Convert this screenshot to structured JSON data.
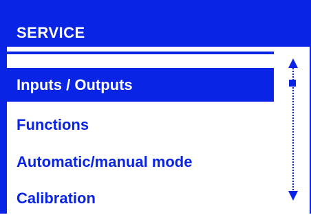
{
  "header": {
    "title": "SERVICE"
  },
  "menu": {
    "items": [
      {
        "label": "Inputs / Outputs",
        "selected": true
      },
      {
        "label": "Functions",
        "selected": false
      },
      {
        "label": "Automatic/manual mode",
        "selected": false
      },
      {
        "label": "Calibration",
        "selected": false
      }
    ]
  },
  "scrollbar": {
    "up_icon": "triangle-up",
    "down_icon": "triangle-down",
    "position_fraction": 0.1
  },
  "colors": {
    "accent": "#0a24e6",
    "background": "#ffffff",
    "selected_text": "#ffffff"
  }
}
